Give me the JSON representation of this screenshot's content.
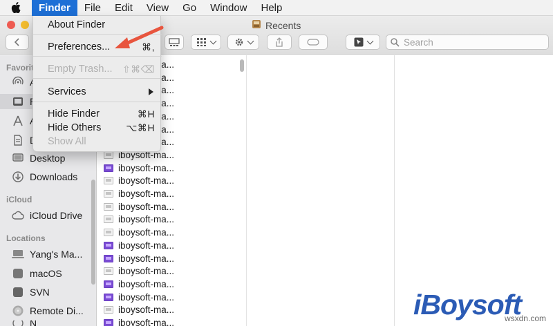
{
  "menubar": {
    "apple_icon": "apple-icon",
    "items": [
      {
        "label": "Finder",
        "active": true
      },
      {
        "label": "File"
      },
      {
        "label": "Edit"
      },
      {
        "label": "View"
      },
      {
        "label": "Go"
      },
      {
        "label": "Window"
      },
      {
        "label": "Help"
      }
    ]
  },
  "finder_menu": {
    "about": "About Finder",
    "preferences": "Preferences...",
    "preferences_shortcut": "⌘,",
    "empty_trash": "Empty Trash...",
    "empty_trash_shortcut": "⇧⌘⌫",
    "services": "Services",
    "hide_finder": "Hide Finder",
    "hide_finder_shortcut": "⌘H",
    "hide_others": "Hide Others",
    "hide_others_shortcut": "⌥⌘H",
    "show_all": "Show All"
  },
  "window": {
    "title": "Recents",
    "search_placeholder": "Search"
  },
  "sidebar": {
    "favorites_header": "Favorites",
    "favorites_visible": "Favorit",
    "items_top": [
      {
        "label": "A",
        "icon": "airdrop-icon"
      },
      {
        "label": "R",
        "icon": "recents-icon",
        "selected": true
      },
      {
        "label": "A",
        "icon": "applications-icon"
      },
      {
        "label": "D",
        "icon": "documents-icon"
      },
      {
        "label": "Desktop",
        "icon": "desktop-icon"
      },
      {
        "label": "Downloads",
        "icon": "downloads-icon"
      }
    ],
    "icloud_header": "iCloud",
    "icloud_drive": "iCloud Drive",
    "locations_header": "Locations",
    "locations": [
      {
        "label": "Yang's Ma...",
        "icon": "computer-icon"
      },
      {
        "label": "macOS",
        "icon": "disk-icon"
      },
      {
        "label": "SVN",
        "icon": "disk-icon"
      },
      {
        "label": "Remote Di...",
        "icon": "disc-icon"
      },
      {
        "label": "N",
        "icon": "network-icon"
      }
    ]
  },
  "files": [
    {
      "name": "iboysoft-ma...",
      "icon": "doc"
    },
    {
      "name": "iboysoft-ma...",
      "icon": "doc"
    },
    {
      "name": "iboysoft-ma...",
      "icon": "doc"
    },
    {
      "name": "iboysoft-ma...",
      "icon": "doc"
    },
    {
      "name": "iboysoft-ma...",
      "icon": "doc"
    },
    {
      "name": "iboysoft-ma...",
      "icon": "doc"
    },
    {
      "name": "iboysoft-ma...",
      "icon": "doc"
    },
    {
      "name": "iboysoft-ma...",
      "icon": "doc"
    },
    {
      "name": "iboysoft-ma...",
      "icon": "purple"
    },
    {
      "name": "iboysoft-ma...",
      "icon": "doc"
    },
    {
      "name": "iboysoft-ma...",
      "icon": "doc"
    },
    {
      "name": "iboysoft-ma...",
      "icon": "doc"
    },
    {
      "name": "iboysoft-ma...",
      "icon": "doc"
    },
    {
      "name": "iboysoft-ma...",
      "icon": "doc"
    },
    {
      "name": "iboysoft-ma...",
      "icon": "purple"
    },
    {
      "name": "iboysoft-ma...",
      "icon": "purple"
    },
    {
      "name": "iboysoft-ma...",
      "icon": "doc"
    },
    {
      "name": "iboysoft-ma...",
      "icon": "purple"
    },
    {
      "name": "iboysoft-ma...",
      "icon": "purple"
    },
    {
      "name": "iboysoft-ma...",
      "icon": "doc"
    },
    {
      "name": "iboysoft-ma...",
      "icon": "purple"
    }
  ],
  "watermark": {
    "brand": "iBoysoft",
    "site": "wsxdn.com"
  },
  "colors": {
    "accent": "#1d6fd6",
    "brand": "#2b5bb5",
    "arrow": "#e8553e"
  }
}
